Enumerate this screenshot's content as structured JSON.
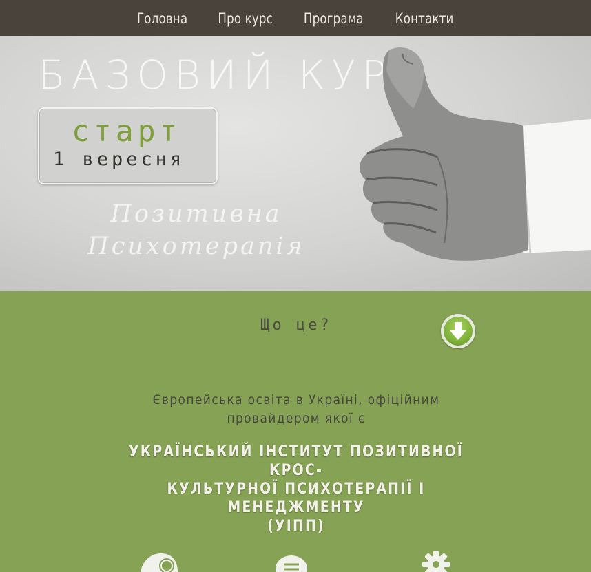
{
  "nav": {
    "items": [
      {
        "label": "Головна"
      },
      {
        "label": "Про курс"
      },
      {
        "label": "Програма"
      },
      {
        "label": "Контакти"
      }
    ]
  },
  "hero": {
    "title": "БАЗОВИЙ КУРС",
    "start_word": "старт",
    "start_date": "1 вересня",
    "subtitle_line1": "Позитивна",
    "subtitle_line2": "Психотерапія"
  },
  "section": {
    "what_title": "Що це?",
    "down_icon": "arrow-down-circle-icon",
    "intro_line1": "Європейська освіта в Україні, офіційним",
    "intro_line2": "провайдером якої є",
    "institute_line1": "УКРАЇНСЬКИЙ ІНСТИТУТ ПОЗИТИВНОЇ КРОС-",
    "institute_line2": "КУЛЬТУРНОЇ ПСИХОТЕРАПІЇ І МЕНЕДЖМЕНТУ",
    "institute_line3": "(УІПП)"
  },
  "features": {
    "icons": [
      "head-lightbulb-icon",
      "speech-bubble-icon",
      "gear-icon"
    ]
  },
  "colors": {
    "nav_bg": "#4a433c",
    "green_bg": "#86a254",
    "accent_green": "#7f9e3c"
  }
}
